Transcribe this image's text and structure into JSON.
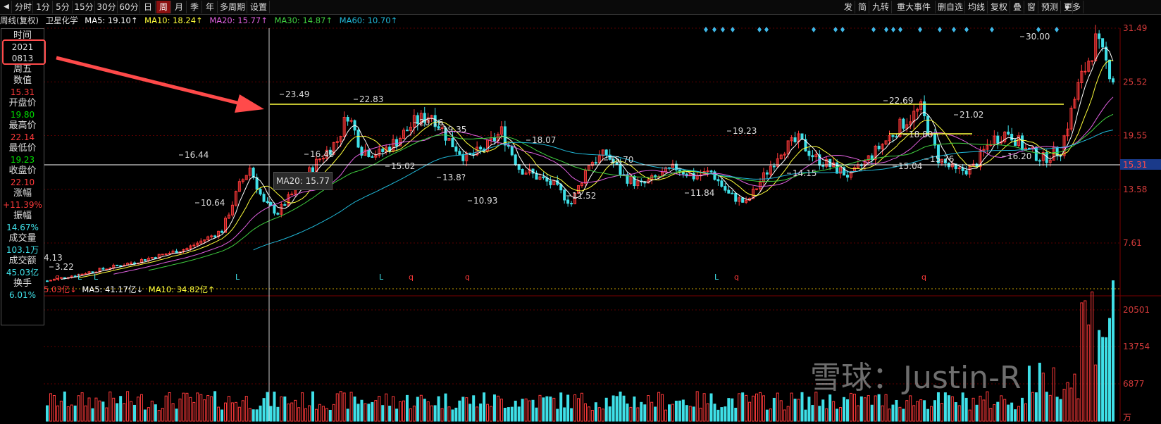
{
  "toolbar": {
    "left_items": [
      "分时",
      "1分",
      "5分",
      "15分",
      "30分",
      "60分",
      "日",
      "周",
      "月",
      "季",
      "年",
      "多周期",
      "设置"
    ],
    "active_index": 7,
    "right_items": [
      "发",
      "简",
      "九转",
      "重大事件",
      "删自选",
      "均线",
      "复权",
      "叠",
      "窗",
      "预测",
      "更多"
    ]
  },
  "status": {
    "period": "周线(复权)",
    "stock_name": "卫星化学",
    "ma5": "MA5: 19.10↑",
    "ma10": "MA10: 18.24↑",
    "ma20": "MA20: 15.77↑",
    "ma30": "MA30: 14.87↑",
    "ma60": "MA60: 10.70↑"
  },
  "info_panel": {
    "time_label": "时间",
    "year": "2021",
    "date": "0813",
    "weekday": "周五",
    "value_label": "数值",
    "value": "15.31",
    "open_label": "开盘价",
    "open": "19.80",
    "high_label": "最高价",
    "high": "22.14",
    "low_label": "最低价",
    "low": "19.23",
    "close_label": "收盘价",
    "close": "22.10",
    "change_label": "涨幅",
    "change": "+11.39%",
    "amplitude_label": "振幅",
    "amplitude": "14.67%",
    "volume_label": "成交量",
    "volume": "103.1万",
    "turnover_label": "成交额",
    "turnover": "45.03亿",
    "hand_label": "换手",
    "hand": "6.01%"
  },
  "price_axis": [
    "31.49",
    "25.52",
    "19.55",
    "13.58",
    "7.61"
  ],
  "current_price_tag": "15.31",
  "volume_axis": [
    "20501",
    "13754",
    "6877"
  ],
  "volume_unit": "万",
  "price_annotations": [
    "30.00",
    "23.49",
    "22.83",
    "22.69",
    "21.02",
    "20.16",
    "19.35",
    "19.23",
    "18.07",
    "16.44",
    "16.40",
    "15.70",
    "15.02",
    "15.04",
    "15.76",
    "16.20",
    "14.15",
    "13.8?",
    "11.52",
    "11.84",
    "10.93",
    "10.64",
    "4.13",
    "3.22",
    "18.80"
  ],
  "tooltip": "MA20: 15.77",
  "volume_status": {
    "vol": "5.03亿↓",
    "ma5": "MA5: 41.17亿↓",
    "ma10": "MA10: 34.82亿↑"
  },
  "watermark": "雪球：Justin-R",
  "colors": {
    "up": "#ff3a3a",
    "down": "#3fe0e8",
    "ma5": "#ffffff",
    "ma10": "#ffff3a",
    "ma20": "#e060e0",
    "ma30": "#40d040",
    "ma60": "#20b8d8",
    "resistance_line": "#ffff40"
  }
}
